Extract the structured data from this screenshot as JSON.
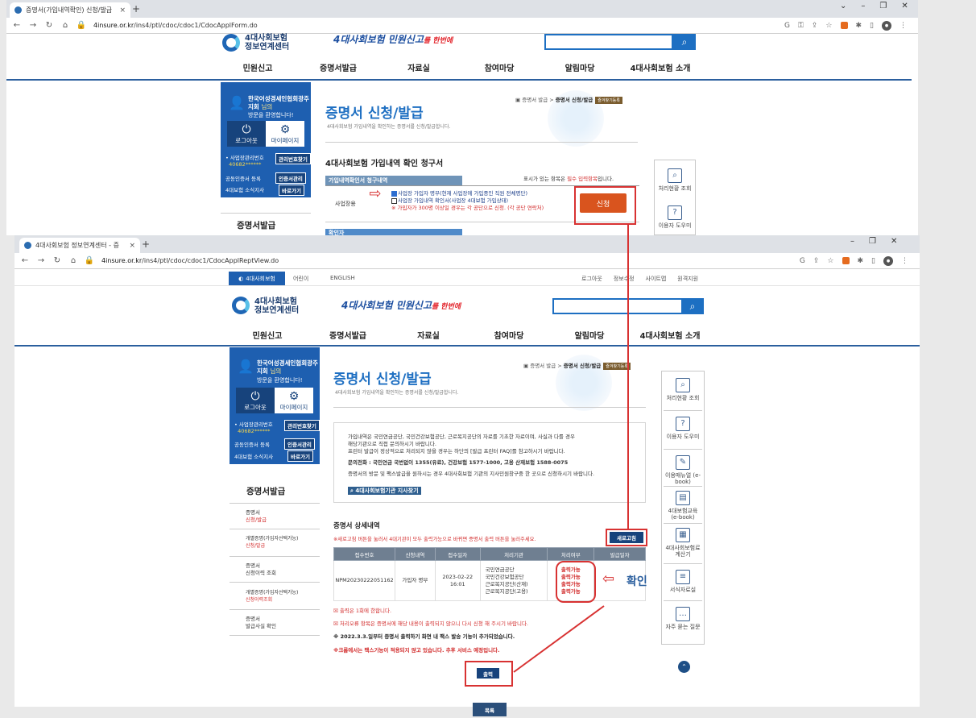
{
  "browser1": {
    "tab_title": "증명서(가입내역확인) 신청/발급",
    "url_host": "4insure.or.kr",
    "url_path": "/ins4/ptl/cdoc/cdoc1/CdocApplForm.do"
  },
  "browser2": {
    "tab_title": "4대사회보험 정보연계센터 - 증",
    "url_host": "4insure.or.kr",
    "url_path": "/ins4/ptl/cdoc/cdoc1/CdocApplReptView.do"
  },
  "topbar": {
    "site_tab": "4대사회보험",
    "links": [
      "어린이",
      "ENGLISH"
    ],
    "right_links": [
      "로그아웃",
      "정보수정",
      "사이트맵",
      "원격지원"
    ]
  },
  "logo": {
    "line1": "4대사회보험",
    "line2": "정보연계센터"
  },
  "slogan": {
    "main": "4대사회보험 민원신고",
    "tail": "를 한번에",
    "mark": "★"
  },
  "nav": [
    "민원신고",
    "증명서발급",
    "자료실",
    "참여마당",
    "알림마당",
    "4대사회보험 소개"
  ],
  "profile": {
    "name": "한국어성경세인협회광주지회",
    "suffix": "님의",
    "welcome": "방문을 환영합니다!",
    "logout": "로그아웃",
    "mypage": "마이페이지",
    "row1_label": "사업장관리번호",
    "row1_value": "40682******",
    "row1_btn": "관리번호찾기",
    "row2_label": "공동인증서 등록",
    "row2_btn": "인증서관리",
    "row3_label": "4대보험 소식지사",
    "row3_btn": "바로가기"
  },
  "page": {
    "title": "증명서 신청/발급",
    "subtitle": "4대사회보험 가입내역을 확인하는 증명서를 신청/발급합니다.",
    "breadcrumb_parent": "증명서 발급",
    "breadcrumb_current": "증명서 신청/발급",
    "badge": "즐겨찾기등록"
  },
  "form": {
    "heading": "4대사회보험 가입내역 확인 청구서",
    "required_note_pre": "표시가 있는 항목은",
    "required_note_em": "필수 입력항목",
    "required_note_post": "입니다.",
    "section_tab": "가입내역확인서 청구내역",
    "row_label": "사업장용",
    "opt1": "사업장 가입자 명부(현재 사업장에 가입중인 직원 전체명단)",
    "opt2": "사업장 가입내역 확인서(사업장 4대보험 가입상태)",
    "warn": "※ 가입자가 300명 이상일 경우는 각 공단으로 신청. (각 공단 연락처)",
    "apply_btn": "신청",
    "next_tab": "확인자"
  },
  "sidemenu": {
    "title": "증명서발급",
    "items": [
      {
        "l1": "증명서",
        "l2": "신청/발급",
        "active": true
      },
      {
        "l1": "개별증명(가입자선택가능)",
        "l2": "신청/발급",
        "active": false
      },
      {
        "l1": "증명서",
        "l2": "신청이력 조회",
        "active": false
      },
      {
        "l1": "개별증명(가입자선택가능)",
        "l2": "신청이력조회",
        "active": false
      },
      {
        "l1": "증명서",
        "l2": "발급사실 확인",
        "active": false
      }
    ]
  },
  "rightpanel": [
    {
      "label": "처리현황 조회",
      "icon": "document-search-icon",
      "glyph": "🔍"
    },
    {
      "label": "이용자 도우미",
      "icon": "help-monitor-icon",
      "glyph": "?"
    },
    {
      "label": "이용매뉴얼 (e-book)",
      "icon": "manual-edit-icon",
      "glyph": "✎"
    },
    {
      "label": "4대보험교육 (e-book)",
      "icon": "book-icon",
      "glyph": "▤"
    },
    {
      "label": "4대사회보험료 계산기",
      "icon": "calculator-icon",
      "glyph": "▦"
    },
    {
      "label": "서식자료실",
      "icon": "form-document-icon",
      "glyph": "≡"
    },
    {
      "label": "자주 묻는 질문",
      "icon": "faq-chat-icon",
      "glyph": "…"
    }
  ],
  "info": {
    "p1": "가입내역은 국민연금공단, 국민건강보험공단, 근로복지공단의 자료를 기초한 자료이며, 사실과 다를 경우",
    "p2": "해당기관으로 직접 문의하시기 바랍니다.",
    "p3": "프린터 발급이 정상적으로 처리되지 않을 경우는 하단의 [발급 프린터 FAQ]를 참고하시기 바랍니다.",
    "phone": "문의전화 : 국민연금 국번없이 1355(유료), 건강보험 1577-1000, 고용 산재보험 1588-0075",
    "p4": "증명서의 방문 및 팩스발급을 원하시는 경우 4대사회보험 기관의 지사민원창구중 한 곳으로 신청하시기 바랍니다.",
    "link": "4대사회보험기관 지사찾기"
  },
  "detail": {
    "heading": "증명서 상세내역",
    "notice": "※새로고침 버튼을 눌러서 4대기관이 모두 출력가능으로 바뀌면 증명서 출력 버튼을 눌러주세요.",
    "refresh": "새로고침",
    "columns": [
      "접수번호",
      "신청내역",
      "접수일자",
      "처리기관",
      "처리여부",
      "발급일자"
    ],
    "row": {
      "receipt_no": "NPM20230222051162",
      "request": "가입자 명부",
      "date": "2023-02-22",
      "time": "16:01",
      "agencies": [
        "국민연금공단",
        "국민건강보험공단",
        "근로복지공단(산재)",
        "근로복지공단(고용)"
      ],
      "statuses": [
        "출력가능",
        "출력가능",
        "출력가능",
        "출력가능"
      ],
      "issued": ""
    },
    "notes": [
      "출력은 1회에 한합니다.",
      "처리오류 항목은 증명서에 해당 내용이 출력되지 않으니 다시 신청 해 주시기 바랍니다."
    ],
    "bold_note": "※ 2022.3.3.일부터 증명서 출력하기 화면 내 팩스 발송 기능이 추가되었습니다.",
    "red_note": "※크롬에서는 팩스기능이 적용되지 않고 있습니다. 추후 서비스 예정입니다.",
    "print_btn": "출력",
    "list_btn": "목록",
    "confirm": "확인"
  },
  "colors": {
    "brand": "#1e5fb0",
    "accent": "#d83232",
    "nav_rule": "#2b5f9e"
  }
}
